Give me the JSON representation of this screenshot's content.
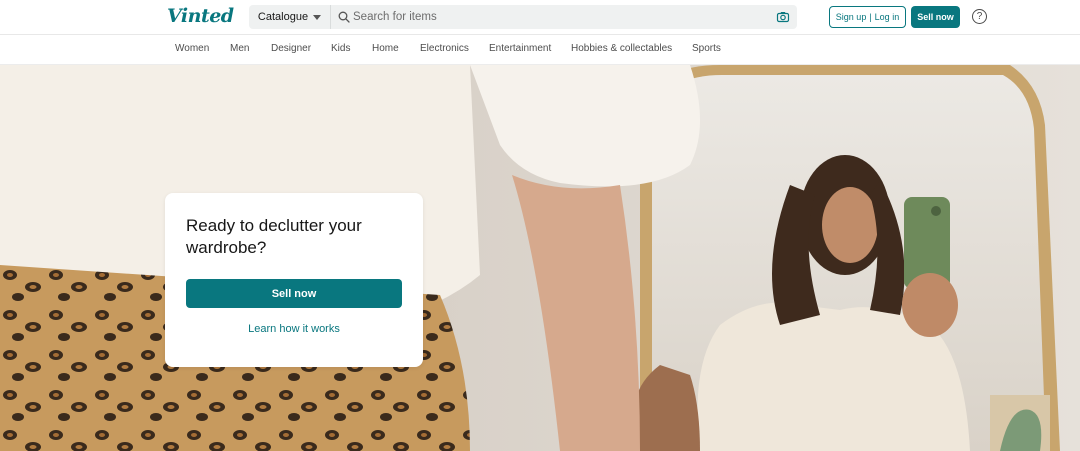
{
  "header": {
    "logo": "Vinted",
    "catalogue_label": "Catalogue",
    "search_placeholder": "Search for items",
    "signup_label": "Sign up",
    "login_label": "Log in",
    "sell_now_label": "Sell now",
    "help_label": "?"
  },
  "categories": [
    "Women",
    "Men",
    "Designer",
    "Kids",
    "Home",
    "Electronics",
    "Entertainment",
    "Hobbies & collectables",
    "Sports"
  ],
  "hero": {
    "title": "Ready to declutter your wardrobe?",
    "sell_now_label": "Sell now",
    "learn_label": "Learn how it works"
  },
  "colors": {
    "brand": "#09777f"
  }
}
